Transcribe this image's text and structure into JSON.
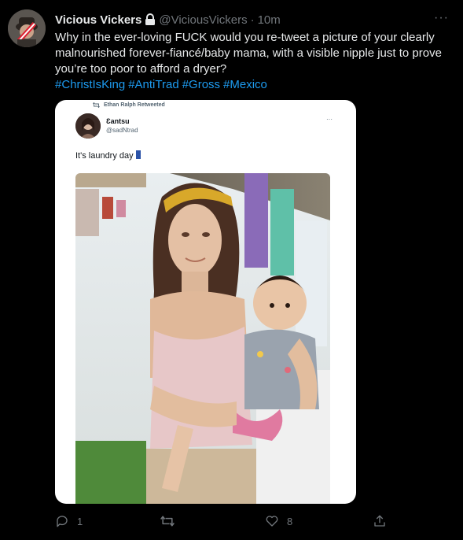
{
  "tweet": {
    "author_name": "Vicious Vickers",
    "handle": "@ViciousVickers",
    "separator": "·",
    "time": "10m",
    "more": "···",
    "text": "Why in the ever-loving FUCK would you re-tweet a picture of your clearly malnourished forever-fiancé/baby mama, with a visible nipple just to prove you’re too poor to afford a dryer?",
    "hashtags": [
      "#ChristIsKing",
      "#AntiTrad",
      "#Gross",
      "#Mexico"
    ]
  },
  "quoted": {
    "retweet_label": "Ethan Ralph Retweeted",
    "author_name": "Ɛantsu",
    "handle": "@sadNtrad",
    "more": "···",
    "text": "It's laundry day"
  },
  "actions": {
    "reply_count": "1",
    "retweet_count": "",
    "like_count": "8"
  },
  "colors": {
    "background": "#000000",
    "text": "#e7e9ea",
    "muted": "#71767b",
    "link": "#1d9bf0",
    "card": "#ffffff"
  },
  "icons": [
    "lock-icon",
    "more-icon",
    "retweet-icon",
    "reply-icon",
    "like-icon",
    "share-icon",
    "jeans-emoji-icon"
  ]
}
